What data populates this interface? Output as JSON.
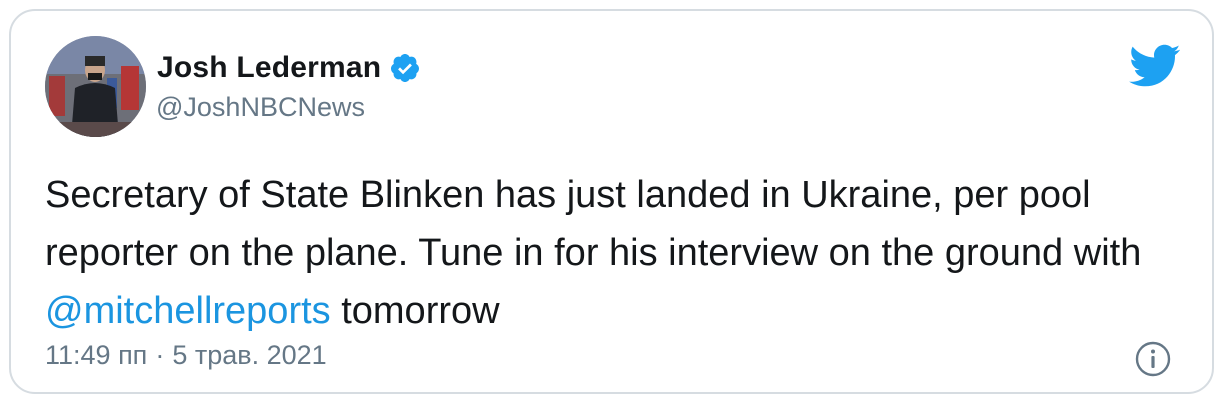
{
  "author": {
    "name": "Josh Lederman",
    "handle": "@JoshNBCNews",
    "verified_icon": "verified-badge",
    "avatar": "profile-photo"
  },
  "tweet": {
    "text_before_mention": "Secretary of State Blinken has just landed in Ukraine, per pool reporter on the plane. Tune in for his interview on the ground with ",
    "mention": "@mitchellreports",
    "text_after_mention": " tomorrow"
  },
  "meta": {
    "time": "11:49 пп",
    "separator": "·",
    "date": "5 трав. 2021"
  },
  "icons": {
    "brand": "twitter-bird-icon",
    "info": "info-icon"
  },
  "colors": {
    "brand_blue": "#1da1f2",
    "mention_blue": "#1b95e0",
    "text_dark": "#14171a",
    "text_muted": "#657786",
    "border": "#d6dce1"
  }
}
